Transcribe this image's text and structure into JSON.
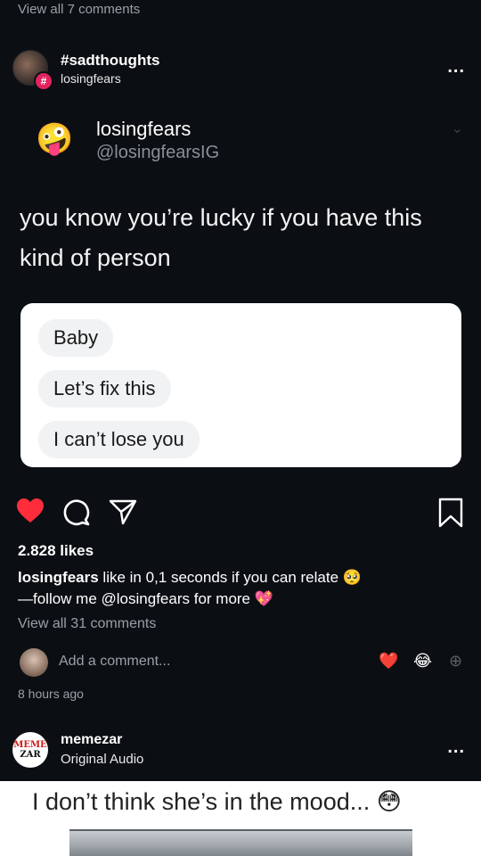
{
  "top_cut": "View all 7 comments",
  "post_header": {
    "title": "#sadthoughts",
    "subtitle": "losingfears",
    "badge": "#",
    "more": "..."
  },
  "tweet": {
    "emoji": "🤪",
    "name": "losingfears",
    "handle": "@losingfearsIG",
    "chevron": "⌄",
    "text": "you know you’re lucky if you have this kind of person"
  },
  "card": {
    "bubbles": [
      "Baby",
      "Let’s fix this",
      "I can’t lose you"
    ]
  },
  "actions": {
    "heart_glyph": "❤",
    "heart_color": "#ff2d3b"
  },
  "likes": "2.828 likes",
  "caption": {
    "user": "losingfears",
    "text": " like in 0,1 seconds if you can relate 🥺",
    "line2": "—follow me @losingfears for more 💖"
  },
  "view_all": "View all 31 comments",
  "comment_bar": {
    "placeholder": "Add a comment...",
    "quick_1": "❤️",
    "quick_2": "😂",
    "quick_3": "⊕"
  },
  "time": "8 hours ago",
  "post2": {
    "logo_line1": "MEME",
    "logo_line2": "ZAR",
    "user": "memezar",
    "audio": "Original Audio",
    "more": "..."
  },
  "banner": {
    "text": "I don’t think she’s in the mood... 😳"
  }
}
